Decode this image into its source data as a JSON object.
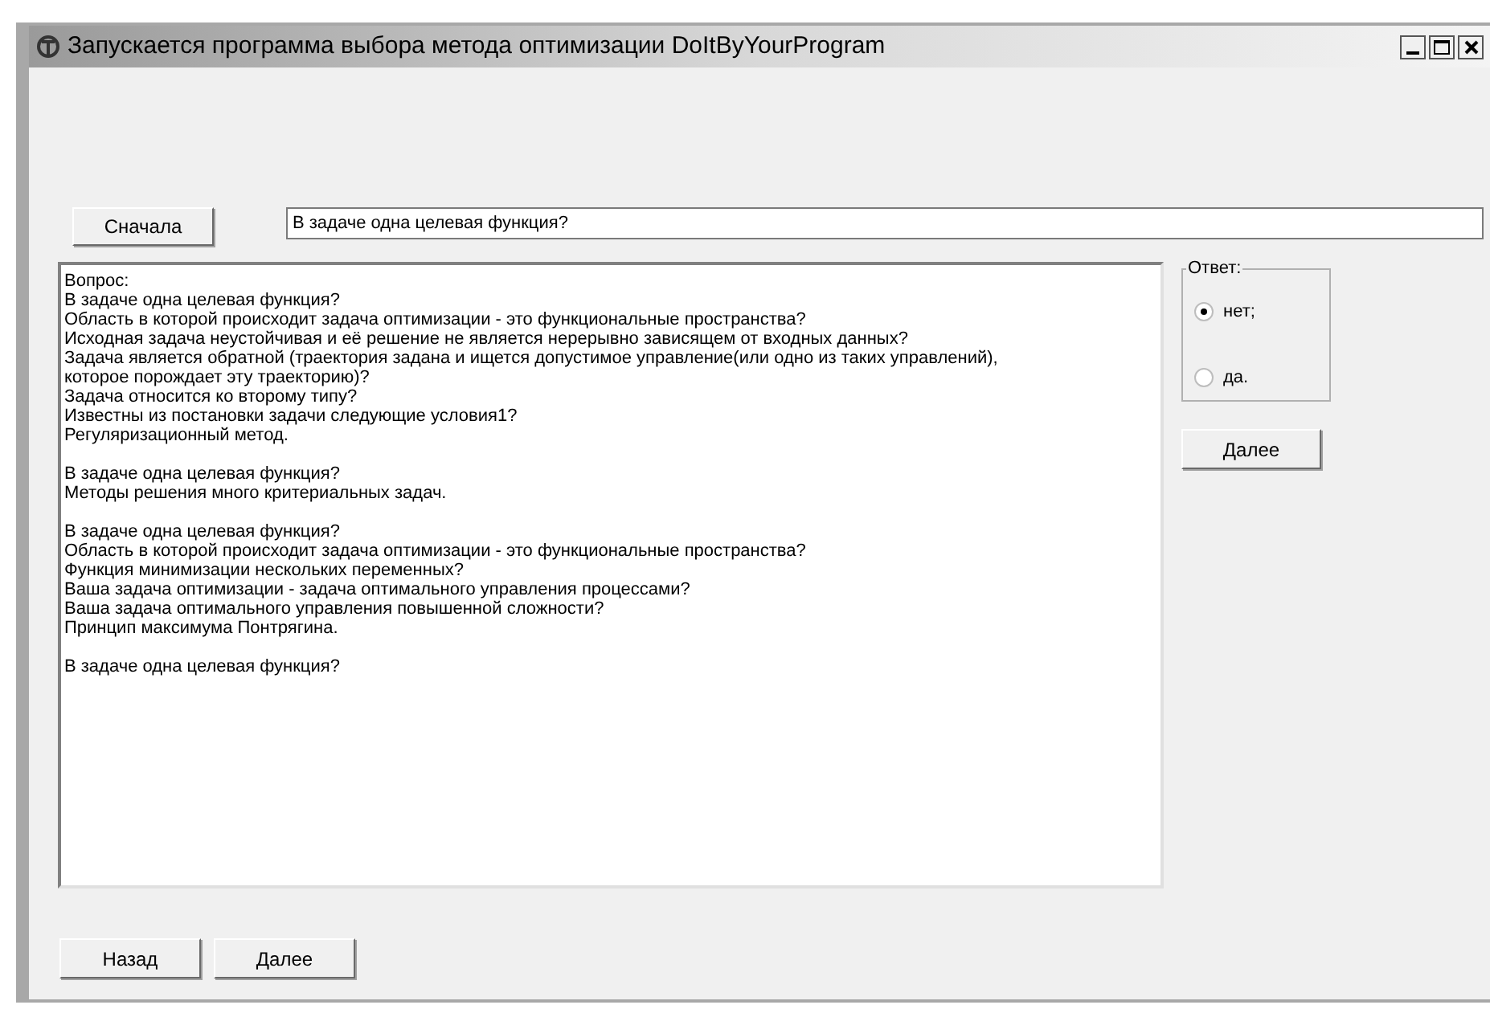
{
  "window": {
    "title": "Запускается программа выбора метода оптимизации DoItByYourProgram"
  },
  "restart_button": "Сначала",
  "question_field": {
    "value": "В задаче одна целевая функция?"
  },
  "log": {
    "blocks": [
      [
        "Вопрос:",
        "В задаче одна целевая функция?",
        "Область в которой происходит задача оптимизации - это функциональные пространства?",
        "Исходная задача неустойчивая и её решение не является нерерывно зависящем от входных данных?",
        "Задача является обратной (траектория задана и ищется допустимое управление(или одно из таких управлений),",
        "которое порождает эту траекторию)?",
        "Задача относится ко второму типу?",
        "Известны из постановки задачи следующие условия1?",
        "Регуляризационный метод."
      ],
      [
        "В задаче одна целевая функция?",
        "Методы решения много критериальных задач."
      ],
      [
        "В задаче одна целевая функция?",
        "Область в которой происходит задача оптимизации - это функциональные пространства?",
        "Функция минимизации нескольких переменных?",
        "Ваша задача оптимизации - задача оптимального управления процессами?",
        "Ваша задача оптимального управления повышенной сложности?",
        "Принцип максимума Понтрягина."
      ],
      [
        "В задаче одна целевая функция?"
      ]
    ]
  },
  "answer_group": {
    "label": "Ответ:",
    "options": [
      {
        "label": "нет;",
        "selected": true
      },
      {
        "label": "да.",
        "selected": false
      }
    ]
  },
  "answer_next_button": "Далее",
  "bottom_buttons": [
    "Назад",
    "Далее"
  ]
}
